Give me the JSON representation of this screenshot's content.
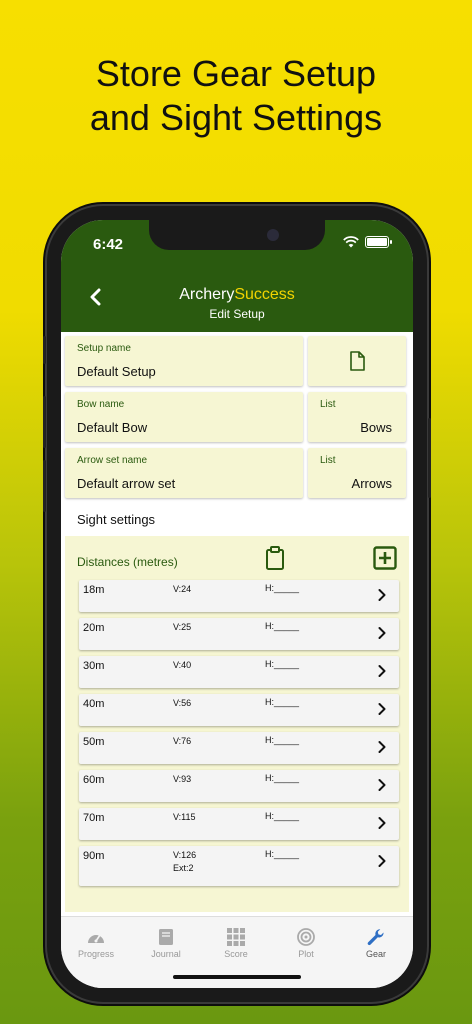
{
  "promo": {
    "line1": "Store Gear Setup",
    "line2": "and Sight Settings"
  },
  "status_bar": {
    "time": "6:42"
  },
  "header": {
    "brand_part1": "Archery",
    "brand_part2": "Success",
    "subtitle": "Edit Setup",
    "accent_color": "#2a5a0f",
    "brand_accent_color": "#f2d400"
  },
  "setup": {
    "setup_name_label": "Setup name",
    "setup_name_value": "Default Setup",
    "bow_name_label": "Bow name",
    "bow_name_value": "Default Bow",
    "bow_list_label": "List",
    "bow_list_value": "Bows",
    "arrow_name_label": "Arrow set name",
    "arrow_name_value": "Default arrow set",
    "arrow_list_label": "List",
    "arrow_list_value": "Arrows"
  },
  "sight": {
    "title": "Sight settings",
    "distances_label": "Distances (metres)",
    "rows": [
      {
        "distance": "18m",
        "v": "V:24",
        "ext": "",
        "h": "H:_____"
      },
      {
        "distance": "20m",
        "v": "V:25",
        "ext": "",
        "h": "H:_____"
      },
      {
        "distance": "30m",
        "v": "V:40",
        "ext": "",
        "h": "H:_____"
      },
      {
        "distance": "40m",
        "v": "V:56",
        "ext": "",
        "h": "H:_____"
      },
      {
        "distance": "50m",
        "v": "V:76",
        "ext": "",
        "h": "H:_____"
      },
      {
        "distance": "60m",
        "v": "V:93",
        "ext": "",
        "h": "H:_____"
      },
      {
        "distance": "70m",
        "v": "V:115",
        "ext": "",
        "h": "H:_____"
      },
      {
        "distance": "90m",
        "v": "V:126",
        "ext": "Ext:2",
        "h": "H:_____"
      }
    ]
  },
  "tabs": [
    {
      "label": "Progress",
      "icon": "gauge-icon"
    },
    {
      "label": "Journal",
      "icon": "book-icon"
    },
    {
      "label": "Score",
      "icon": "grid-icon"
    },
    {
      "label": "Plot",
      "icon": "target-icon"
    },
    {
      "label": "Gear",
      "icon": "wrench-icon",
      "active": true
    }
  ]
}
